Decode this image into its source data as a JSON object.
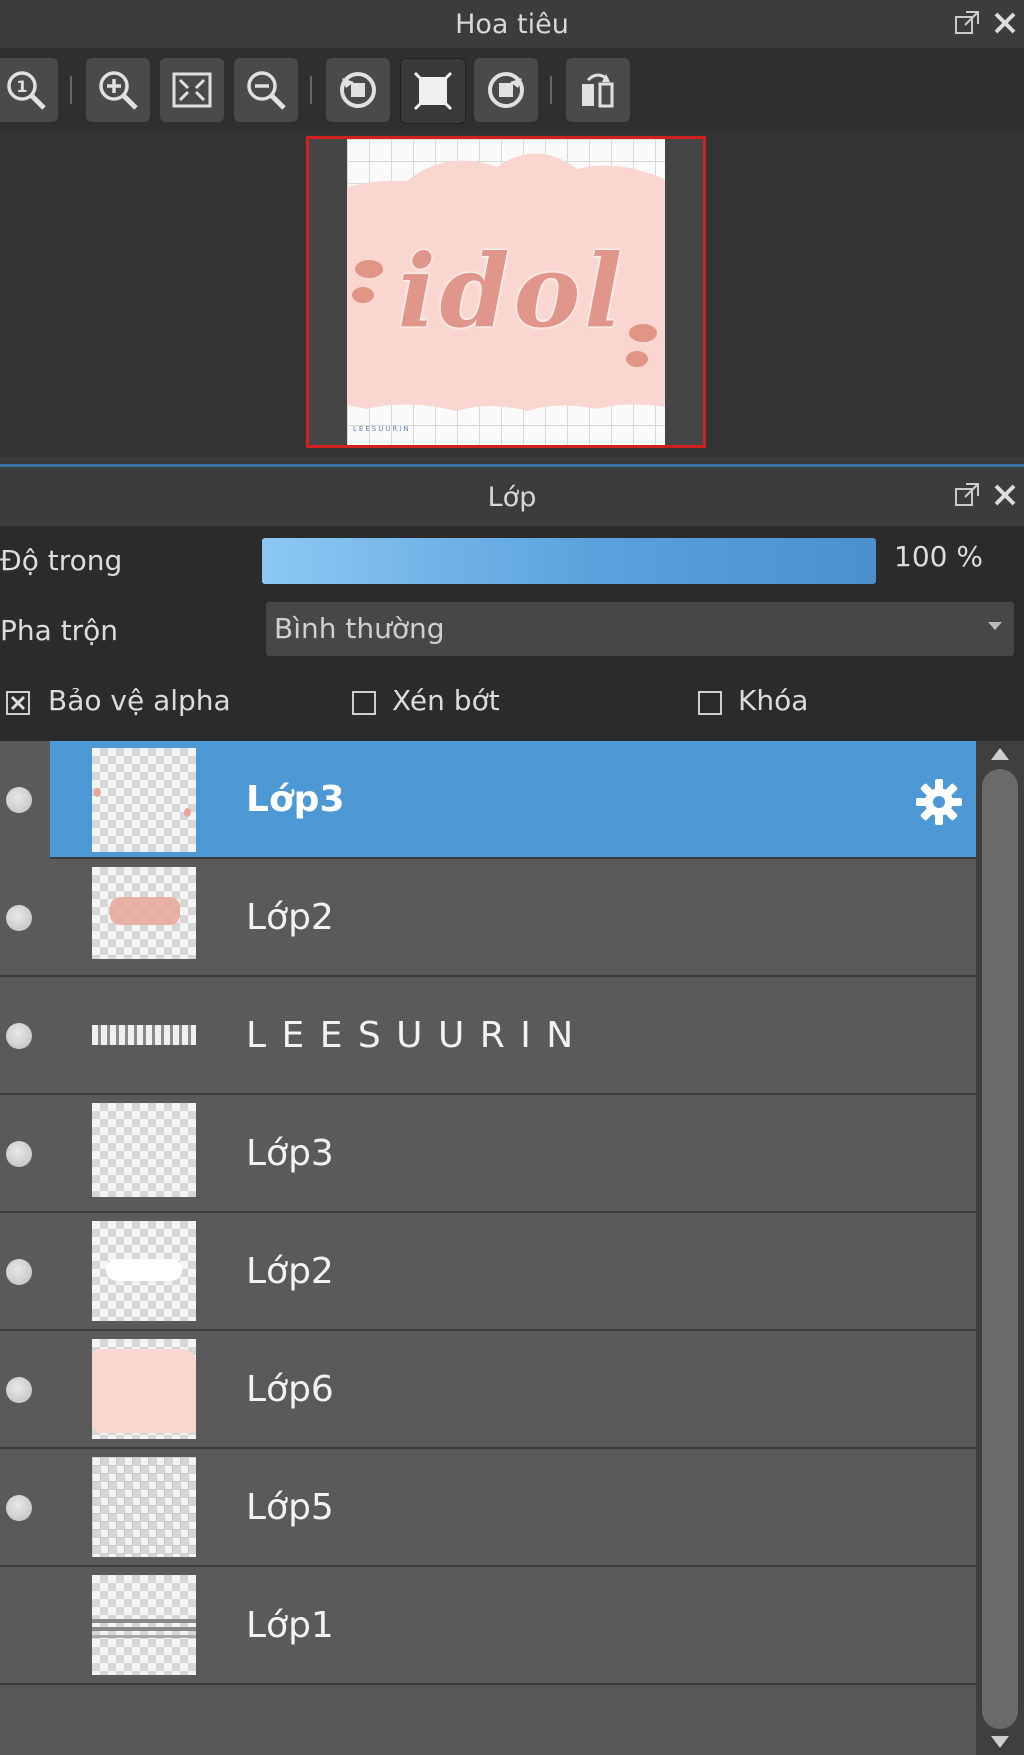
{
  "navigator": {
    "title": "Hoa tiêu",
    "tools": [
      "zoom-actual-icon",
      "zoom-in-icon",
      "fit-screen-icon",
      "zoom-out-icon",
      "rotate-left-icon",
      "fit-canvas-icon",
      "rotate-right-icon",
      "flip-horizontal-icon"
    ],
    "preview": {
      "text": "idol",
      "footer_text": "LEESUURIN"
    }
  },
  "layers_panel": {
    "title": "Lớp",
    "opacity_label": "Độ trong",
    "opacity_value": "100 %",
    "opacity_fraction": 1.0,
    "blend_label": "Pha trộn",
    "blend_value": "Bình thường",
    "protect_alpha_label": "Bảo vệ alpha",
    "protect_alpha_checked": true,
    "clipping_label": "Xén bớt",
    "clipping_checked": false,
    "lock_label": "Khóa",
    "lock_checked": false,
    "layers": [
      {
        "name": "Lớp3",
        "selected": true,
        "visible": true,
        "thumb": "drops"
      },
      {
        "name": "Lớp2",
        "selected": false,
        "visible": true,
        "thumb": "idol"
      },
      {
        "name": "L E E S U U R I N",
        "selected": false,
        "visible": true,
        "thumb": "text-strip"
      },
      {
        "name": "Lớp3",
        "selected": false,
        "visible": true,
        "thumb": "empty"
      },
      {
        "name": "Lớp2",
        "selected": false,
        "visible": true,
        "thumb": "white"
      },
      {
        "name": "Lớp6",
        "selected": false,
        "visible": true,
        "thumb": "pink"
      },
      {
        "name": "Lớp5",
        "selected": false,
        "visible": true,
        "thumb": "grid"
      },
      {
        "name": "Lớp1",
        "selected": false,
        "visible": false,
        "thumb": "lines"
      }
    ]
  },
  "colors": {
    "accent": "#4d99d5",
    "pink": "#f9d6cf",
    "text_pink": "#e0968a",
    "frame_red": "#d02020"
  }
}
